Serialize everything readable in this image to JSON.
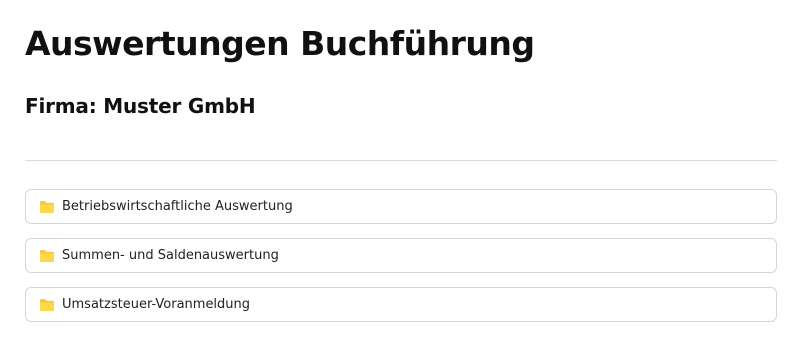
{
  "header": {
    "title": "Auswertungen Buchführung",
    "company": "Firma: Muster GmbH"
  },
  "folders": {
    "items": [
      {
        "label": "Betriebswirtschaftliche Auswertung",
        "icon": "folder-icon"
      },
      {
        "label": "Summen- und Saldenauswertung",
        "icon": "folder-icon"
      },
      {
        "label": "Umsatzsteuer-Voranmeldung",
        "icon": "folder-icon"
      }
    ]
  },
  "colors": {
    "folder_icon": "#f6c83f",
    "border": "#d6d6d6",
    "divider": "#dcdcdc",
    "text": "#111111"
  }
}
